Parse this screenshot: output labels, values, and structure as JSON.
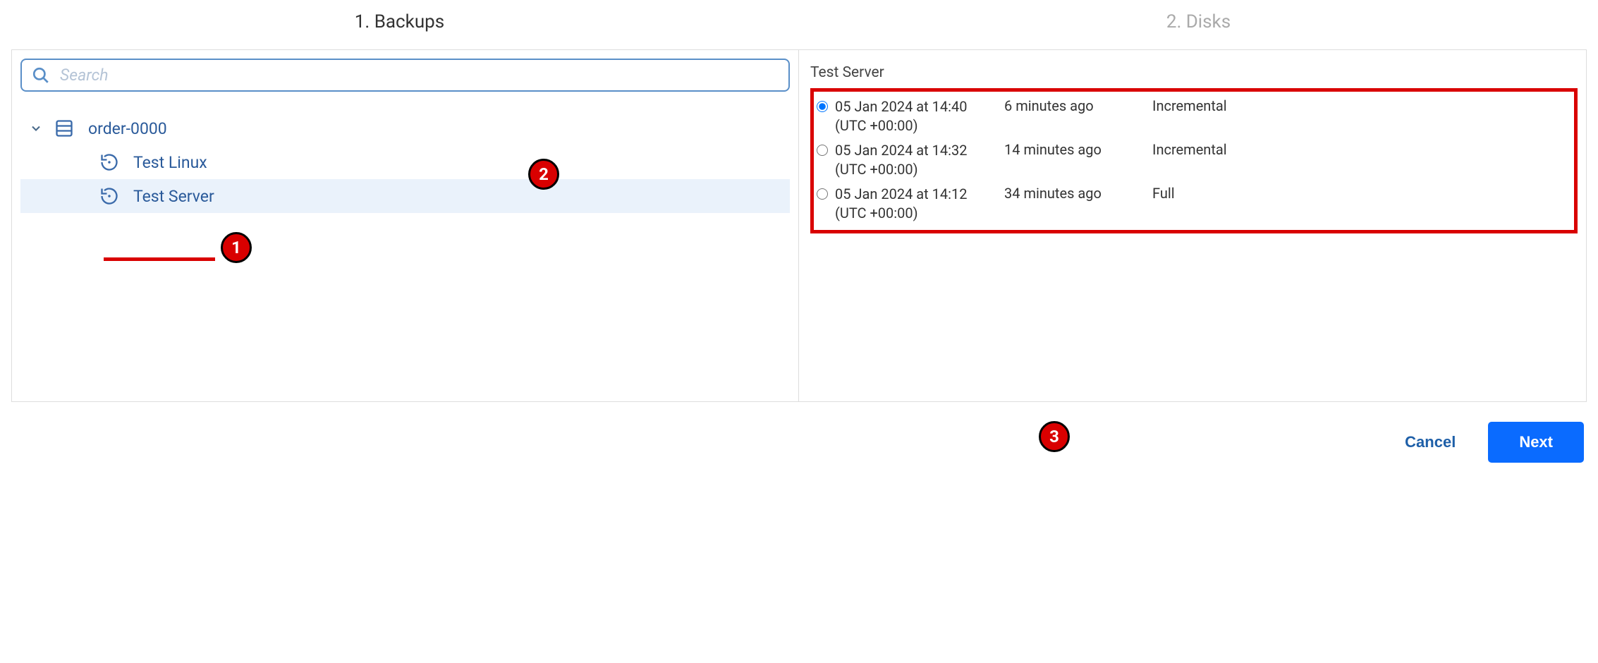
{
  "steps": {
    "step1": "1. Backups",
    "step2": "2. Disks"
  },
  "search": {
    "placeholder": "Search"
  },
  "tree": {
    "root_label": "order-0000",
    "child1_label": "Test Linux",
    "child2_label": "Test Server"
  },
  "details": {
    "header": "Test Server",
    "backups": [
      {
        "datetime": "05 Jan 2024 at 14:40 (UTC +00:00)",
        "age": "6 minutes ago",
        "type": "Incremental",
        "selected": true
      },
      {
        "datetime": "05 Jan 2024 at 14:32 (UTC +00:00)",
        "age": "14 minutes ago",
        "type": "Incremental",
        "selected": false
      },
      {
        "datetime": "05 Jan 2024 at 14:12 (UTC +00:00)",
        "age": "34 minutes ago",
        "type": "Full",
        "selected": false
      }
    ]
  },
  "footer": {
    "cancel": "Cancel",
    "next": "Next"
  },
  "callouts": {
    "c1": "1",
    "c2": "2",
    "c3": "3"
  }
}
